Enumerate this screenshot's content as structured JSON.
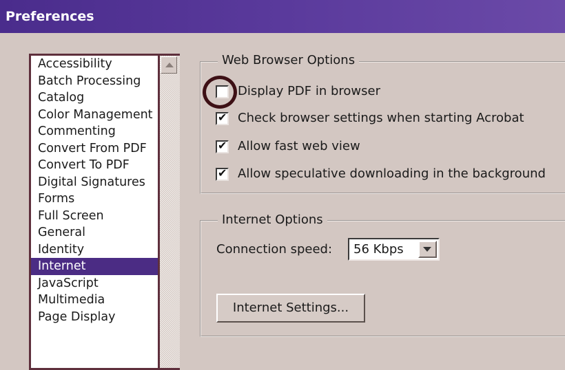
{
  "window": {
    "title": "Preferences"
  },
  "categories": [
    "Accessibility",
    "Batch Processing",
    "Catalog",
    "Color Management",
    "Commenting",
    "Convert From PDF",
    "Convert To PDF",
    "Digital Signatures",
    "Forms",
    "Full Screen",
    "General",
    "Identity",
    "Internet",
    "JavaScript",
    "Multimedia",
    "Page Display"
  ],
  "selected_category": "Internet",
  "web_browser_options": {
    "legend": "Web Browser Options",
    "items": [
      {
        "label": "Display PDF in browser",
        "checked": false
      },
      {
        "label": "Check browser settings when starting Acrobat",
        "checked": true
      },
      {
        "label": "Allow fast web view",
        "checked": true
      },
      {
        "label": "Allow speculative downloading in the background",
        "checked": true
      }
    ]
  },
  "internet_options": {
    "legend": "Internet Options",
    "connection_speed_label": "Connection speed:",
    "connection_speed_value": "56 Kbps",
    "internet_settings_button": "Internet Settings..."
  },
  "colors": {
    "title_bar": "#4a2c8c",
    "selection": "#4b2c84",
    "highlight_circle": "#3d1015"
  }
}
